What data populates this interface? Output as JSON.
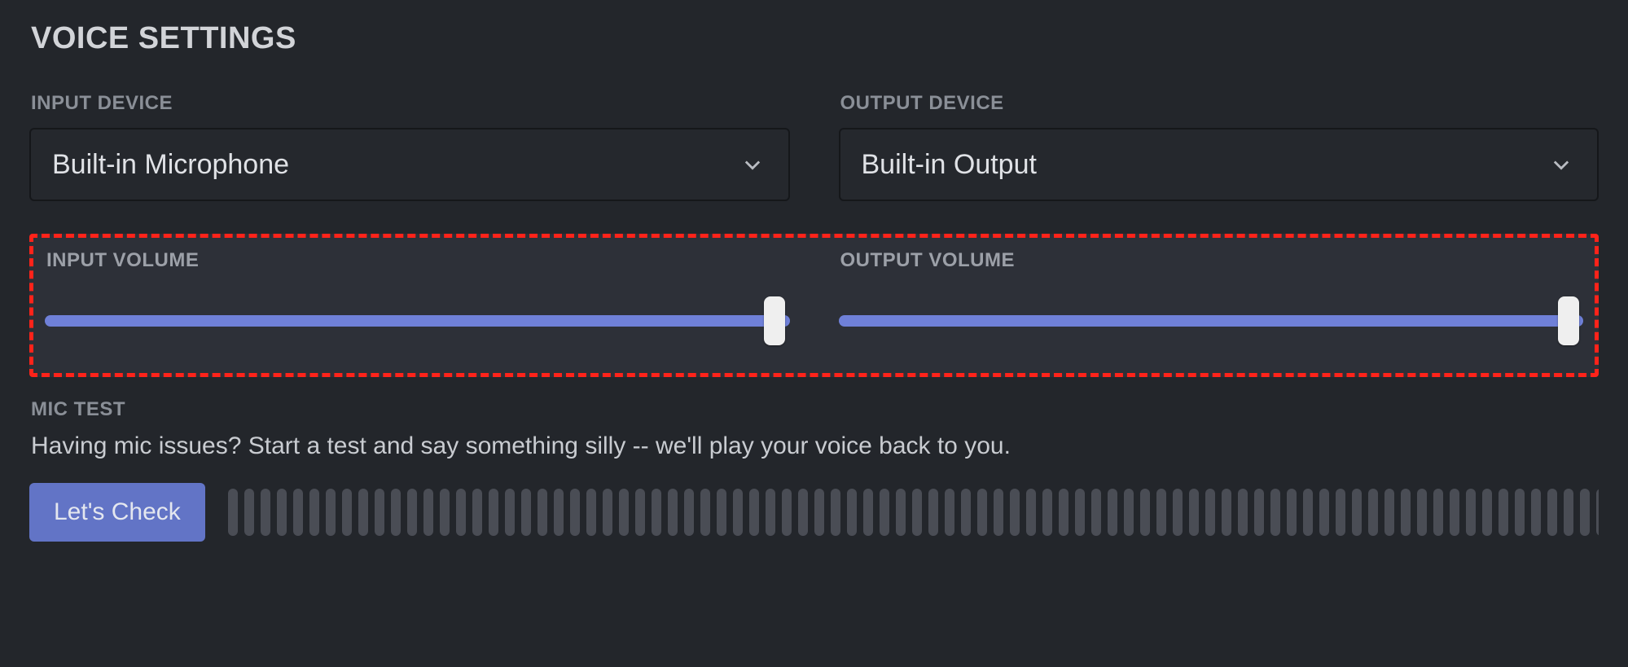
{
  "page_title": "VOICE SETTINGS",
  "input_device": {
    "label": "INPUT DEVICE",
    "selected": "Built-in Microphone"
  },
  "output_device": {
    "label": "OUTPUT DEVICE",
    "selected": "Built-in Output"
  },
  "input_volume": {
    "label": "INPUT VOLUME",
    "percent": 98
  },
  "output_volume": {
    "label": "OUTPUT VOLUME",
    "percent": 98
  },
  "mic_test": {
    "label": "MIC TEST",
    "description": "Having mic issues? Start a test and say something silly -- we'll play your voice back to you.",
    "button_label": "Let's Check",
    "meter_segments": 86
  },
  "colors": {
    "accent": "#6f80d8",
    "highlight_border": "#ff231a"
  }
}
